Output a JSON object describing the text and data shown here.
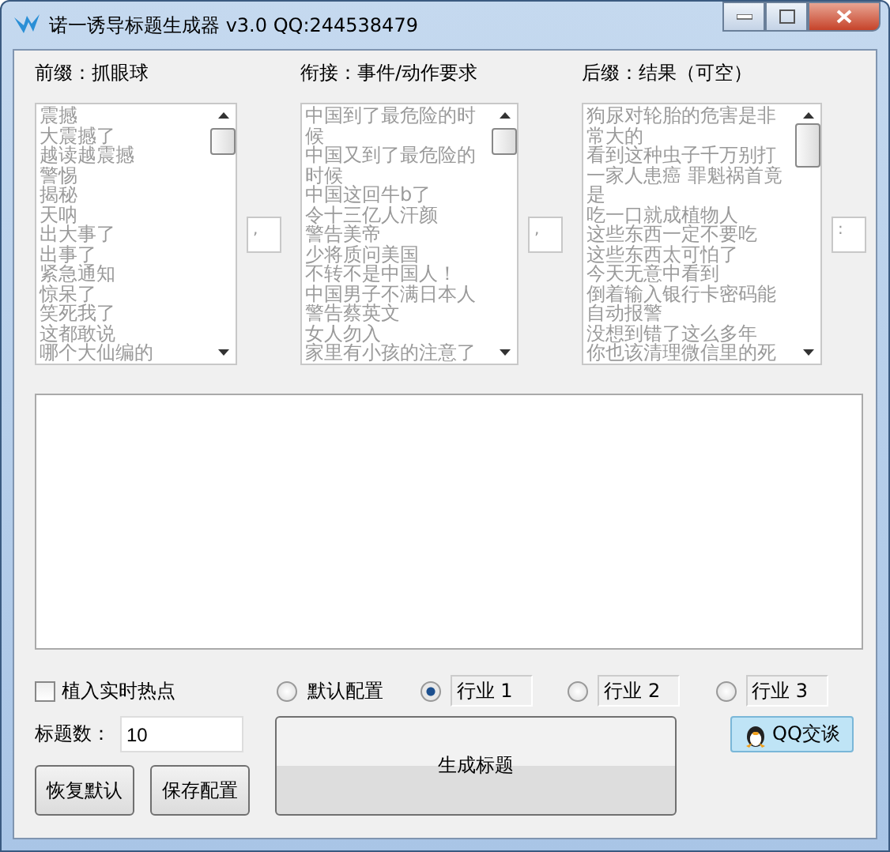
{
  "window": {
    "title": "诺一诱导标题生成器 v3.0 QQ:244538479"
  },
  "lists": [
    {
      "label": "前缀：抓眼球",
      "separator": ",",
      "items": [
        "震撼",
        "大震撼了",
        "越读越震撼",
        "警惕",
        "揭秘",
        "天呐",
        "出大事了",
        "出事了",
        "紧急通知",
        "惊呆了",
        "笑死我了",
        "这都敢说",
        "哪个大仙编的"
      ]
    },
    {
      "label": "衔接：事件/动作要求",
      "separator": ",",
      "items": [
        "中国到了最危险的时候",
        "中国又到了最危险的时候",
        "中国这回牛b了",
        "令十三亿人汗颜",
        "警告美帝",
        "少将质问美国",
        "不转不是中国人！",
        "中国男子不满日本人",
        "警告蔡英文",
        "女人勿入",
        "家里有小孩的注意了"
      ]
    },
    {
      "label": "后缀：结果（可空）",
      "separator": ":",
      "items": [
        "狗尿对轮胎的危害是非常大的",
        "看到这种虫子千万别打",
        "一家人患癌 罪魁祸首竟是",
        "吃一口就成植物人",
        "这些东西一定不要吃",
        "这些东西太可怕了",
        "今天无意中看到",
        "倒着输入银行卡密码能自动报警",
        "没想到错了这么多年",
        "你也该清理微信里的死"
      ]
    }
  ],
  "hotspot": {
    "label": "植入实时热点",
    "checked": false
  },
  "presets": [
    {
      "label": "默认配置",
      "selected": false,
      "kind": "plain"
    },
    {
      "label": "行业 1",
      "selected": true,
      "kind": "boxed"
    },
    {
      "label": "行业 2",
      "selected": false,
      "kind": "boxed"
    },
    {
      "label": "行业 3",
      "selected": false,
      "kind": "boxed"
    }
  ],
  "count": {
    "label": "标题数：",
    "value": "10"
  },
  "buttons": [
    "恢复默认",
    "保存配置"
  ],
  "generate": "生成标题",
  "qq": "QQ交谈"
}
